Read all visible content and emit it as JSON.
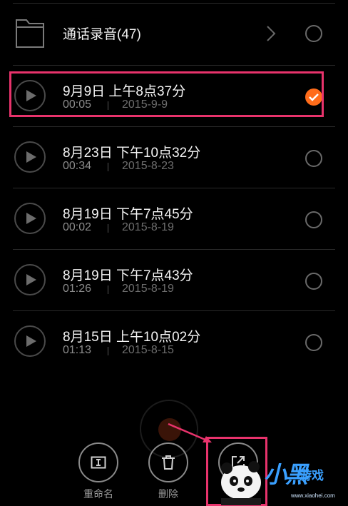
{
  "folder": {
    "label": "通话录音(47)",
    "icon": "folder-icon"
  },
  "recordings": [
    {
      "title": "9月9日 上午8点37分",
      "duration": "00:05",
      "date": "2015-9-9",
      "selected": true
    },
    {
      "title": "8月23日 下午10点32分",
      "duration": "00:34",
      "date": "2015-8-23",
      "selected": false
    },
    {
      "title": "8月19日 下午7点45分",
      "duration": "00:02",
      "date": "2015-8-19",
      "selected": false
    },
    {
      "title": "8月19日 下午7点43分",
      "duration": "01:26",
      "date": "2015-8-19",
      "selected": false
    },
    {
      "title": "8月15日 上午10点02分",
      "duration": "01:13",
      "date": "2015-8-15",
      "selected": false
    }
  ],
  "bottom_bar": {
    "rename_label": "重命名",
    "delete_label": "删除"
  },
  "watermark": {
    "text": "小黑",
    "sub": "游戏",
    "url": "www.xiaohei.com"
  },
  "colors": {
    "accent": "#ff6c1a",
    "highlight": "#e8336c",
    "background": "#000000"
  }
}
